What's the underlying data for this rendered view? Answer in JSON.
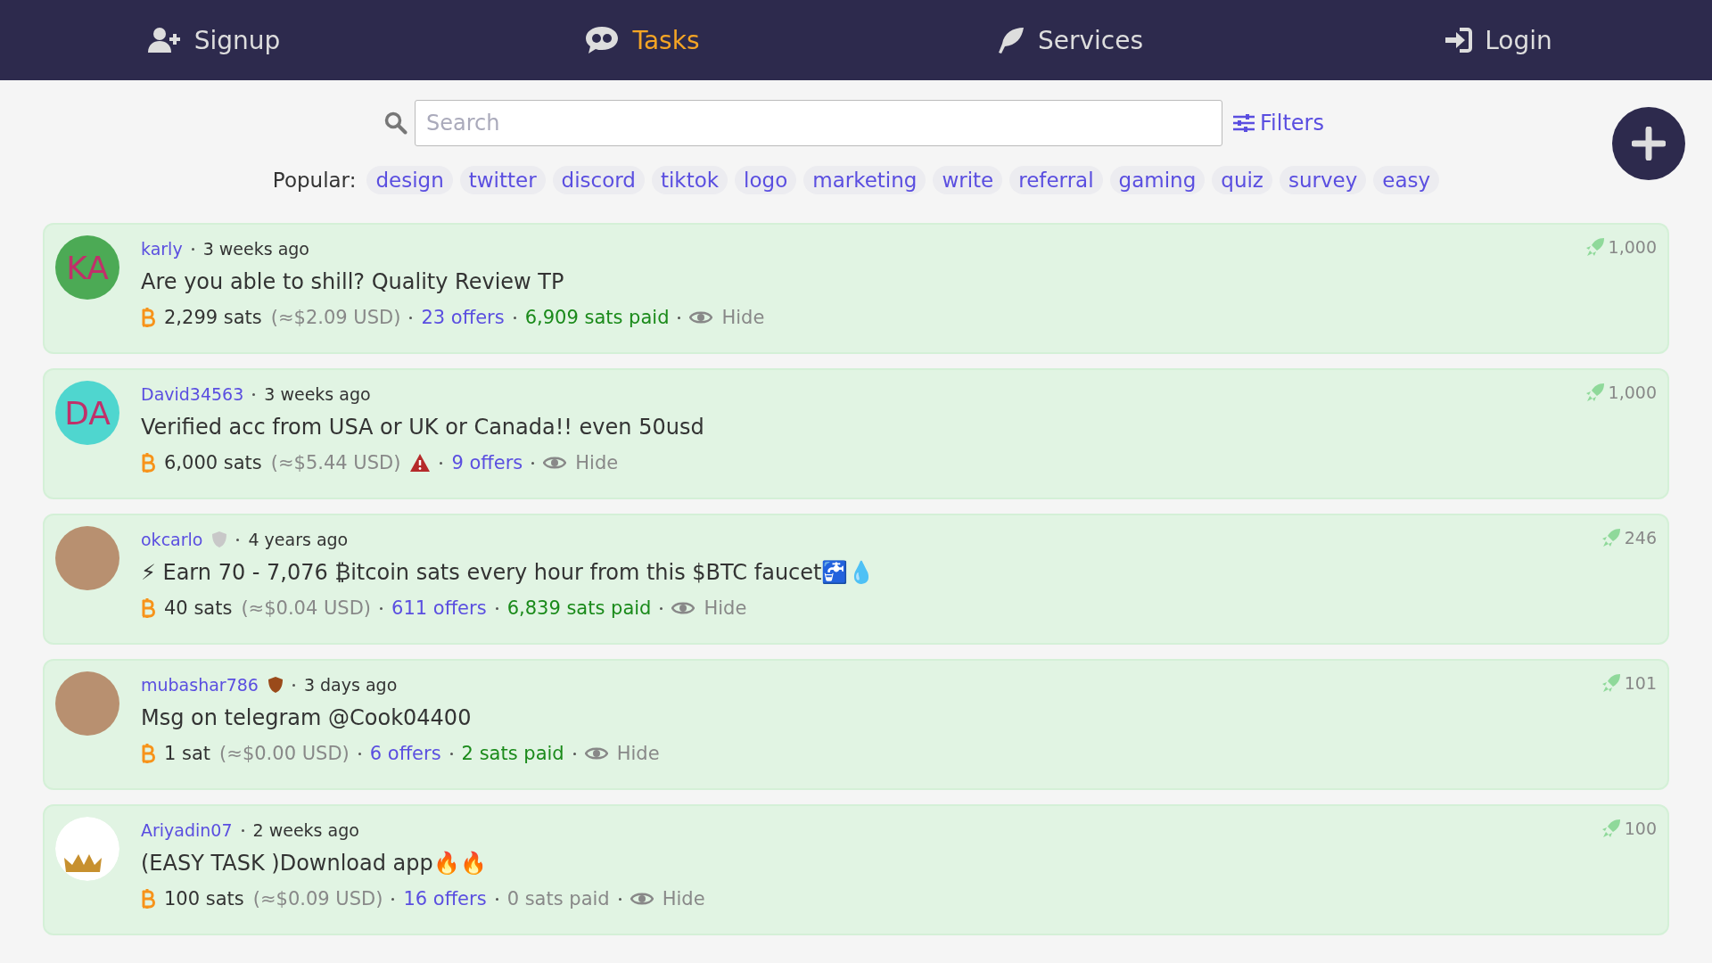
{
  "nav": [
    {
      "label": "Signup",
      "selected": false
    },
    {
      "label": "Tasks",
      "selected": true
    },
    {
      "label": "Services",
      "selected": false
    },
    {
      "label": "Login",
      "selected": false
    }
  ],
  "search": {
    "placeholder": "Search",
    "filters_label": "Filters"
  },
  "popular": {
    "label": "Popular:",
    "tags": [
      "design",
      "twitter",
      "discord",
      "tiktok",
      "logo",
      "marketing",
      "write",
      "referral",
      "gaming",
      "quiz",
      "survey",
      "easy"
    ]
  },
  "tasks": [
    {
      "user": "karly",
      "time": "3 weeks ago",
      "avatar": {
        "kind": "initials",
        "text": "KA",
        "color": "#4caa55"
      },
      "title": "Are you able to shill? Quality Review TP",
      "amount": "2,299 sats",
      "usd": "(≈$2.09 USD)",
      "warning": false,
      "offers": "23 offers",
      "paid": "6,909 sats paid",
      "paid_highlight": true,
      "hide": "Hide",
      "boost": "1,000"
    },
    {
      "user": "David34563",
      "time": "3 weeks ago",
      "avatar": {
        "kind": "initials",
        "text": "DA",
        "color": "#4fd6cf"
      },
      "title": "Verified acc from USA or UK or Canada!! even 50usd",
      "amount": "6,000 sats",
      "usd": "(≈$5.44 USD)",
      "warning": true,
      "offers": "9 offers",
      "hide": "Hide",
      "boost": "1,000"
    },
    {
      "user": "okcarlo",
      "badge": {
        "color": "#c8c8c8"
      },
      "time": "4 years ago",
      "avatar": {
        "kind": "photo"
      },
      "title": "⚡ Earn 70 - 7,076 ₿itcoin sats every hour from this $BTC faucet🚰💧",
      "amount": "40 sats",
      "usd": "(≈$0.04 USD)",
      "warning": false,
      "offers": "611 offers",
      "paid": "6,839 sats paid",
      "paid_highlight": true,
      "hide": "Hide",
      "boost": "246"
    },
    {
      "user": "mubashar786",
      "badge": {
        "color": "#9a4a1a"
      },
      "time": "3 days ago",
      "avatar": {
        "kind": "photo"
      },
      "title": "Msg on telegram @Cook04400",
      "amount": "1 sat",
      "usd": "(≈$0.00 USD)",
      "warning": false,
      "offers": "6 offers",
      "paid": "2 sats paid",
      "paid_highlight": true,
      "hide": "Hide",
      "boost": "101"
    },
    {
      "user": "Ariyadin07",
      "time": "2 weeks ago",
      "avatar": {
        "kind": "crown"
      },
      "title": "(EASY TASK )Download app🔥🔥",
      "amount": "100 sats",
      "usd": "(≈$0.09 USD)",
      "warning": false,
      "offers": "16 offers",
      "paid": "0 sats paid",
      "paid_highlight": false,
      "hide": "Hide",
      "boost": "100"
    }
  ]
}
